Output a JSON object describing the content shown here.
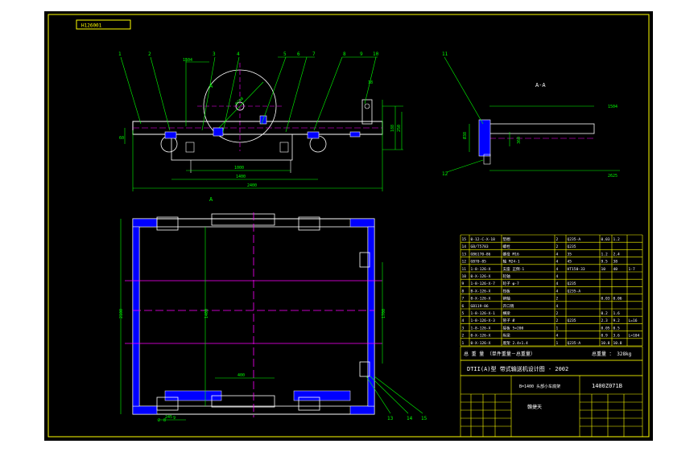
{
  "drawing": {
    "code_box": "H126001",
    "section_label": "A-A",
    "section_mark": "A",
    "colors": {
      "background": "#000000",
      "frame": "#ffff00",
      "geometry": "#ffffff",
      "dimension": "#00ff00",
      "centerline": "#ff00ff",
      "section_fill": "#0000ff",
      "text": "#ffffff"
    }
  },
  "top_view": {
    "balloons": [
      "1",
      "2",
      "3",
      "4",
      "5",
      "6",
      "7",
      "8",
      "9",
      "10"
    ],
    "dims": {
      "width_top": "1504",
      "inner_1": "1000",
      "inner_2": "1400",
      "overall": "2400",
      "right_h1": "188",
      "right_h2": "250",
      "radius": "R700",
      "left_small": "60",
      "tag_right": "18"
    }
  },
  "side_view": {
    "balloons": [
      "11",
      "12"
    ],
    "dims": {
      "top": "1504",
      "bottom": "2625",
      "left": "Ø38",
      "mid": "360"
    }
  },
  "plan_view": {
    "balloons": [
      "13",
      "14",
      "15"
    ],
    "bottom_left_labels": [
      "2",
      "8",
      "9"
    ],
    "dims": {
      "left": "2100",
      "center": "1400",
      "right": "1700",
      "bottom_1": "400",
      "bottom_2": "245"
    }
  },
  "bom": {
    "rows": [
      {
        "no": "15",
        "code": "0-12-C-X-18",
        "name": "垫圈",
        "qty": "2",
        "mat": "Q235-A",
        "w1": "0.03",
        "w2": "1.2",
        "note": ""
      },
      {
        "no": "14",
        "code": "GB/T5783",
        "name": "螺栓",
        "qty": "2",
        "mat": "Q235",
        "w1": "",
        "w2": "",
        "note": ""
      },
      {
        "no": "13",
        "code": "GB6170-86",
        "name": "螺母 M16",
        "qty": "4",
        "mat": "35",
        "w1": "1.2",
        "w2": "2.4",
        "note": ""
      },
      {
        "no": "12",
        "code": "GB70-85",
        "name": "轴 M24-1",
        "qty": "4",
        "mat": "45",
        "w1": "9.5",
        "w2": "38",
        "note": ""
      },
      {
        "no": "11",
        "code": "1-8-126-X",
        "name": "支座 正倒-1",
        "qty": "4",
        "mat": "HT150-33",
        "w1": "10",
        "w2": "40",
        "note": "1-7"
      },
      {
        "no": "10",
        "code": "0-X-126-X",
        "name": "轮轴",
        "qty": "4",
        "mat": "",
        "w1": "",
        "w2": "",
        "note": ""
      },
      {
        "no": "9",
        "code": "1-8-126-X-7",
        "name": "轮子 φ-7",
        "qty": "4",
        "mat": "Q235",
        "w1": "",
        "w2": "",
        "note": ""
      },
      {
        "no": "8",
        "code": "B-X-126-X",
        "name": "挡板",
        "qty": "4",
        "mat": "Q235-A",
        "w1": "",
        "w2": "",
        "note": ""
      },
      {
        "no": "7",
        "code": "0-X-126-X",
        "name": "销轴",
        "qty": "2",
        "mat": "",
        "w1": "0.03",
        "w2": "0.06",
        "note": ""
      },
      {
        "no": "6",
        "code": "GB119-86",
        "name": "开口销",
        "qty": "4",
        "mat": "",
        "w1": "",
        "w2": "",
        "note": ""
      },
      {
        "no": "5",
        "code": "1-8-126-X-1",
        "name": "横梁",
        "qty": "2",
        "mat": "",
        "w1": "0.2",
        "w2": "1.6",
        "note": ""
      },
      {
        "no": "4",
        "code": "1-8-126-X-3",
        "name": "管子 Ø",
        "qty": "2",
        "mat": "Q235",
        "w1": "2.3",
        "w2": "9.2",
        "note": "L=16"
      },
      {
        "no": "3",
        "code": "1-8-126-X",
        "name": "接板 5×200",
        "qty": "1",
        "mat": "",
        "w1": "0.05",
        "w2": "0.5",
        "note": ""
      },
      {
        "no": "2",
        "code": "0-X-126-X",
        "name": "纵梁",
        "qty": "4",
        "mat": "",
        "w1": "0.9",
        "w2": "3.6",
        "note": "L=104"
      },
      {
        "no": "1",
        "code": "0-X-126-X",
        "name": "底架 2.4×1.4",
        "qty": "1",
        "mat": "Q235-A",
        "w1": "10.8",
        "w2": "10.8",
        "note": ""
      }
    ],
    "total_left": "总 重 量 （单件重量－总重量）",
    "total_right": "总重量 ： 328kg"
  },
  "title_block": {
    "title": "DTII(A)型 带式输送机设计图 - 2002",
    "spec": "B=1400 头部小车底架",
    "drawing_no": "1400Z071B",
    "unit": "贛捷天"
  }
}
